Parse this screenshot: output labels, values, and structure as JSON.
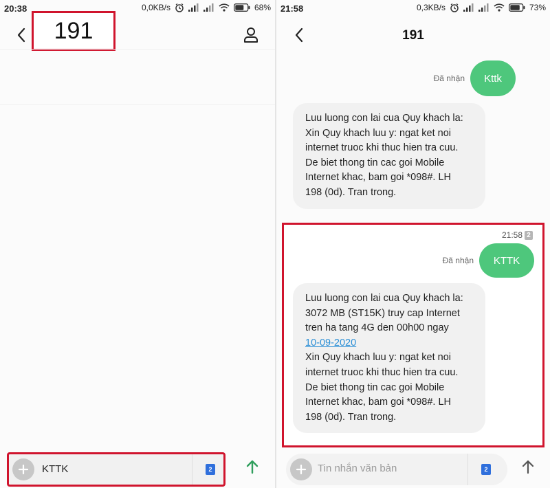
{
  "left": {
    "status": {
      "time": "20:38",
      "netspeed": "0,0KB/s",
      "battery": "68%"
    },
    "header": {
      "title": "191"
    },
    "input": {
      "value": "KTTK",
      "sim_badge": "2"
    },
    "icons": [
      "back-arrow-icon",
      "contact-icon",
      "plus-icon",
      "sim-icon",
      "send-arrow-icon"
    ]
  },
  "right": {
    "status": {
      "time": "21:58",
      "netspeed": "0,3KB/s",
      "battery": "73%"
    },
    "header": {
      "title": "191"
    },
    "messages": {
      "sent_1": {
        "status": "Đã nhận",
        "text": "Kttk"
      },
      "recv_1": {
        "lines": [
          "Luu luong con lai cua Quy khach la:",
          "Xin Quy khach luu y: ngat ket noi",
          "internet truoc khi thuc hien tra cuu.",
          "De biet thong tin cac goi Mobile",
          "Internet khac, bam goi *098#. LH",
          "198 (0d). Tran trong."
        ]
      },
      "timestamp": "21:58",
      "timestamp_sim": "2",
      "sent_2": {
        "status": "Đã nhận",
        "text": "KTTK"
      },
      "recv_2": {
        "lines_before_link": [
          "Luu luong con lai cua Quy khach la:",
          "3072 MB (ST15K) truy cap Internet",
          "tren ha tang 4G den 00h00 ngay"
        ],
        "link": "10-09-2020",
        "lines_after_link": [
          "Xin Quy khach luu y: ngat ket noi",
          "internet truoc khi thuc hien tra cuu.",
          "De biet thong tin cac goi Mobile",
          "Internet khac, bam goi *098#. LH",
          "198 (0d). Tran trong."
        ]
      }
    },
    "input": {
      "placeholder": "Tin nhắn văn bản",
      "sim_badge": "2"
    }
  },
  "colors": {
    "accent_green": "#4ec77c",
    "highlight_red": "#d0142d",
    "link_blue": "#2b8fd6",
    "sim_blue": "#2f6fdc"
  }
}
